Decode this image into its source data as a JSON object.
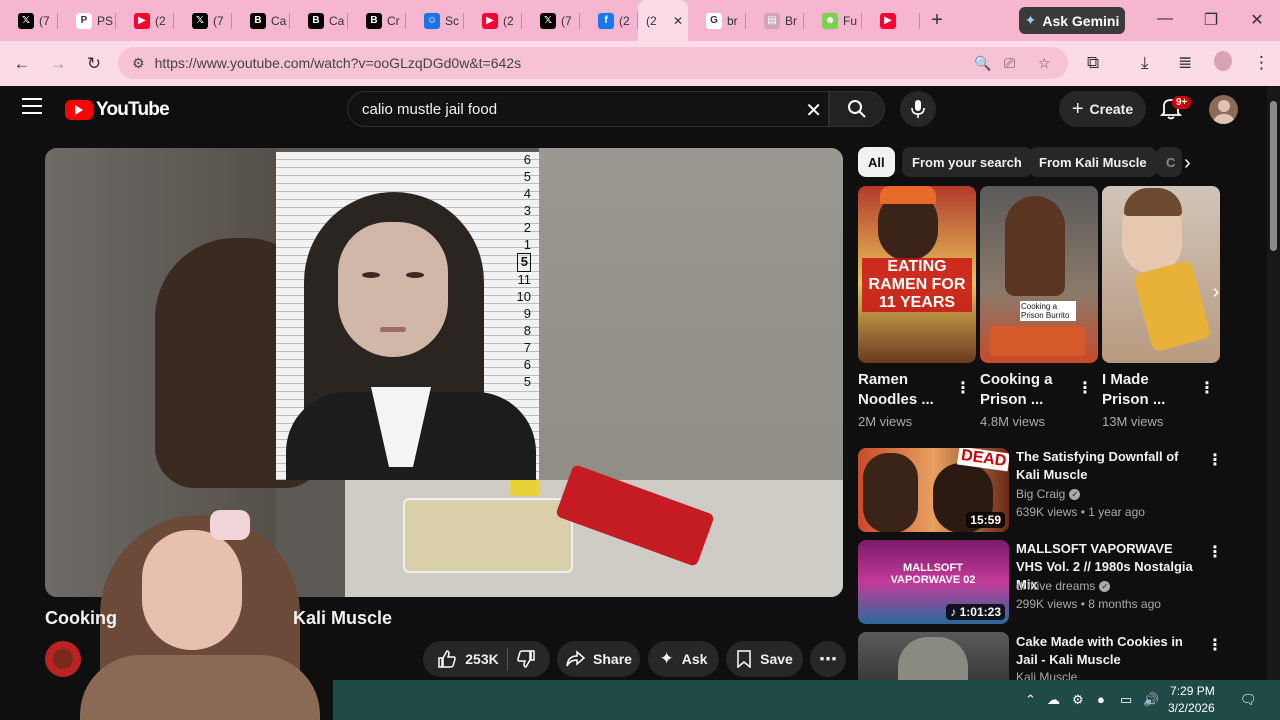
{
  "browser": {
    "tabs": [
      {
        "icon": "x-icon",
        "label": "(7",
        "color": "#000000"
      },
      {
        "icon": "ps-icon",
        "label": "PS",
        "color": "#ffffff"
      },
      {
        "icon": "youtube-icon",
        "label": "(2",
        "color": "#ff0033"
      },
      {
        "icon": "x-icon",
        "label": "(7",
        "color": "#000000"
      },
      {
        "icon": "b-icon",
        "label": "Ca",
        "color": "#000000"
      },
      {
        "icon": "b-icon",
        "label": "Ca",
        "color": "#000000"
      },
      {
        "icon": "b-icon",
        "label": "Cr",
        "color": "#000000"
      },
      {
        "icon": "chat-icon",
        "label": "Sc",
        "color": "#1a73e8"
      },
      {
        "icon": "youtube-icon",
        "label": "(2",
        "color": "#ff0033"
      },
      {
        "icon": "x-icon",
        "label": "(7",
        "color": "#000000"
      },
      {
        "icon": "facebook-icon",
        "label": "(2",
        "color": "#1877f2"
      },
      {
        "icon": "active-tab",
        "label": "(2",
        "color": "#fbdbe8"
      },
      {
        "icon": "google-icon",
        "label": "br",
        "color": "#ffffff"
      },
      {
        "icon": "doc-icon",
        "label": "Br",
        "color": "#cfa5b7"
      },
      {
        "icon": "face-icon",
        "label": "Fu",
        "color": "#7bd34b"
      },
      {
        "icon": "youtube-icon",
        "label": "",
        "color": "#ff0033"
      }
    ],
    "gemini_label": "Ask Gemini",
    "url": "https://www.youtube.com/watch?v=ooGLzqDGd0w&t=642s"
  },
  "youtube": {
    "logo_text": "YouTube",
    "search_query": "calio mustle jail food",
    "create_label": "Create",
    "notifications_badge": "9+"
  },
  "player": {
    "mugshot_scale": [
      "6",
      "5",
      "4",
      "3",
      "2",
      "1",
      "5",
      "11",
      "10",
      "9",
      "8",
      "7",
      "6",
      "5"
    ]
  },
  "video": {
    "title_left": "Cooking",
    "title_right": "Kali Muscle",
    "likes": "253K",
    "share_label": "Share",
    "ask_label": "Ask",
    "save_label": "Save"
  },
  "chips": [
    "All",
    "From your search",
    "From Kali Muscle",
    "C"
  ],
  "shorts": [
    {
      "title": "Ramen Noodles ...",
      "views": "2M views",
      "thumb_text": "EATING RAMEN FOR 11 YEARS"
    },
    {
      "title": "Cooking a Prison ...",
      "views": "4.8M views",
      "thumb_text": "Cooking a Prison Burrito"
    },
    {
      "title": "I Made Prison ...",
      "views": "13M views",
      "thumb_text": ""
    }
  ],
  "related": [
    {
      "title": "The Satisfying Downfall of Kali Muscle",
      "channel": "Big Craig",
      "meta": "639K views • 1 year ago",
      "duration": "15:59",
      "thumb_text": "DEAD"
    },
    {
      "title": "MALLSOFT VAPORWAVE VHS Vol. 2 // 1980s Nostalgia Mix",
      "channel": "drïftive dreams",
      "meta": "299K views • 8 months ago",
      "duration": "1:01:23",
      "thumb_text": "MALLSOFT VAPORWAVE 02"
    },
    {
      "title": "Cake Made with Cookies in Jail - Kali Muscle",
      "channel": "Kali Muscle",
      "meta": "",
      "duration": "",
      "thumb_text": ""
    }
  ],
  "taskbar": {
    "time": "7:29 PM",
    "date": "3/2/2026"
  }
}
